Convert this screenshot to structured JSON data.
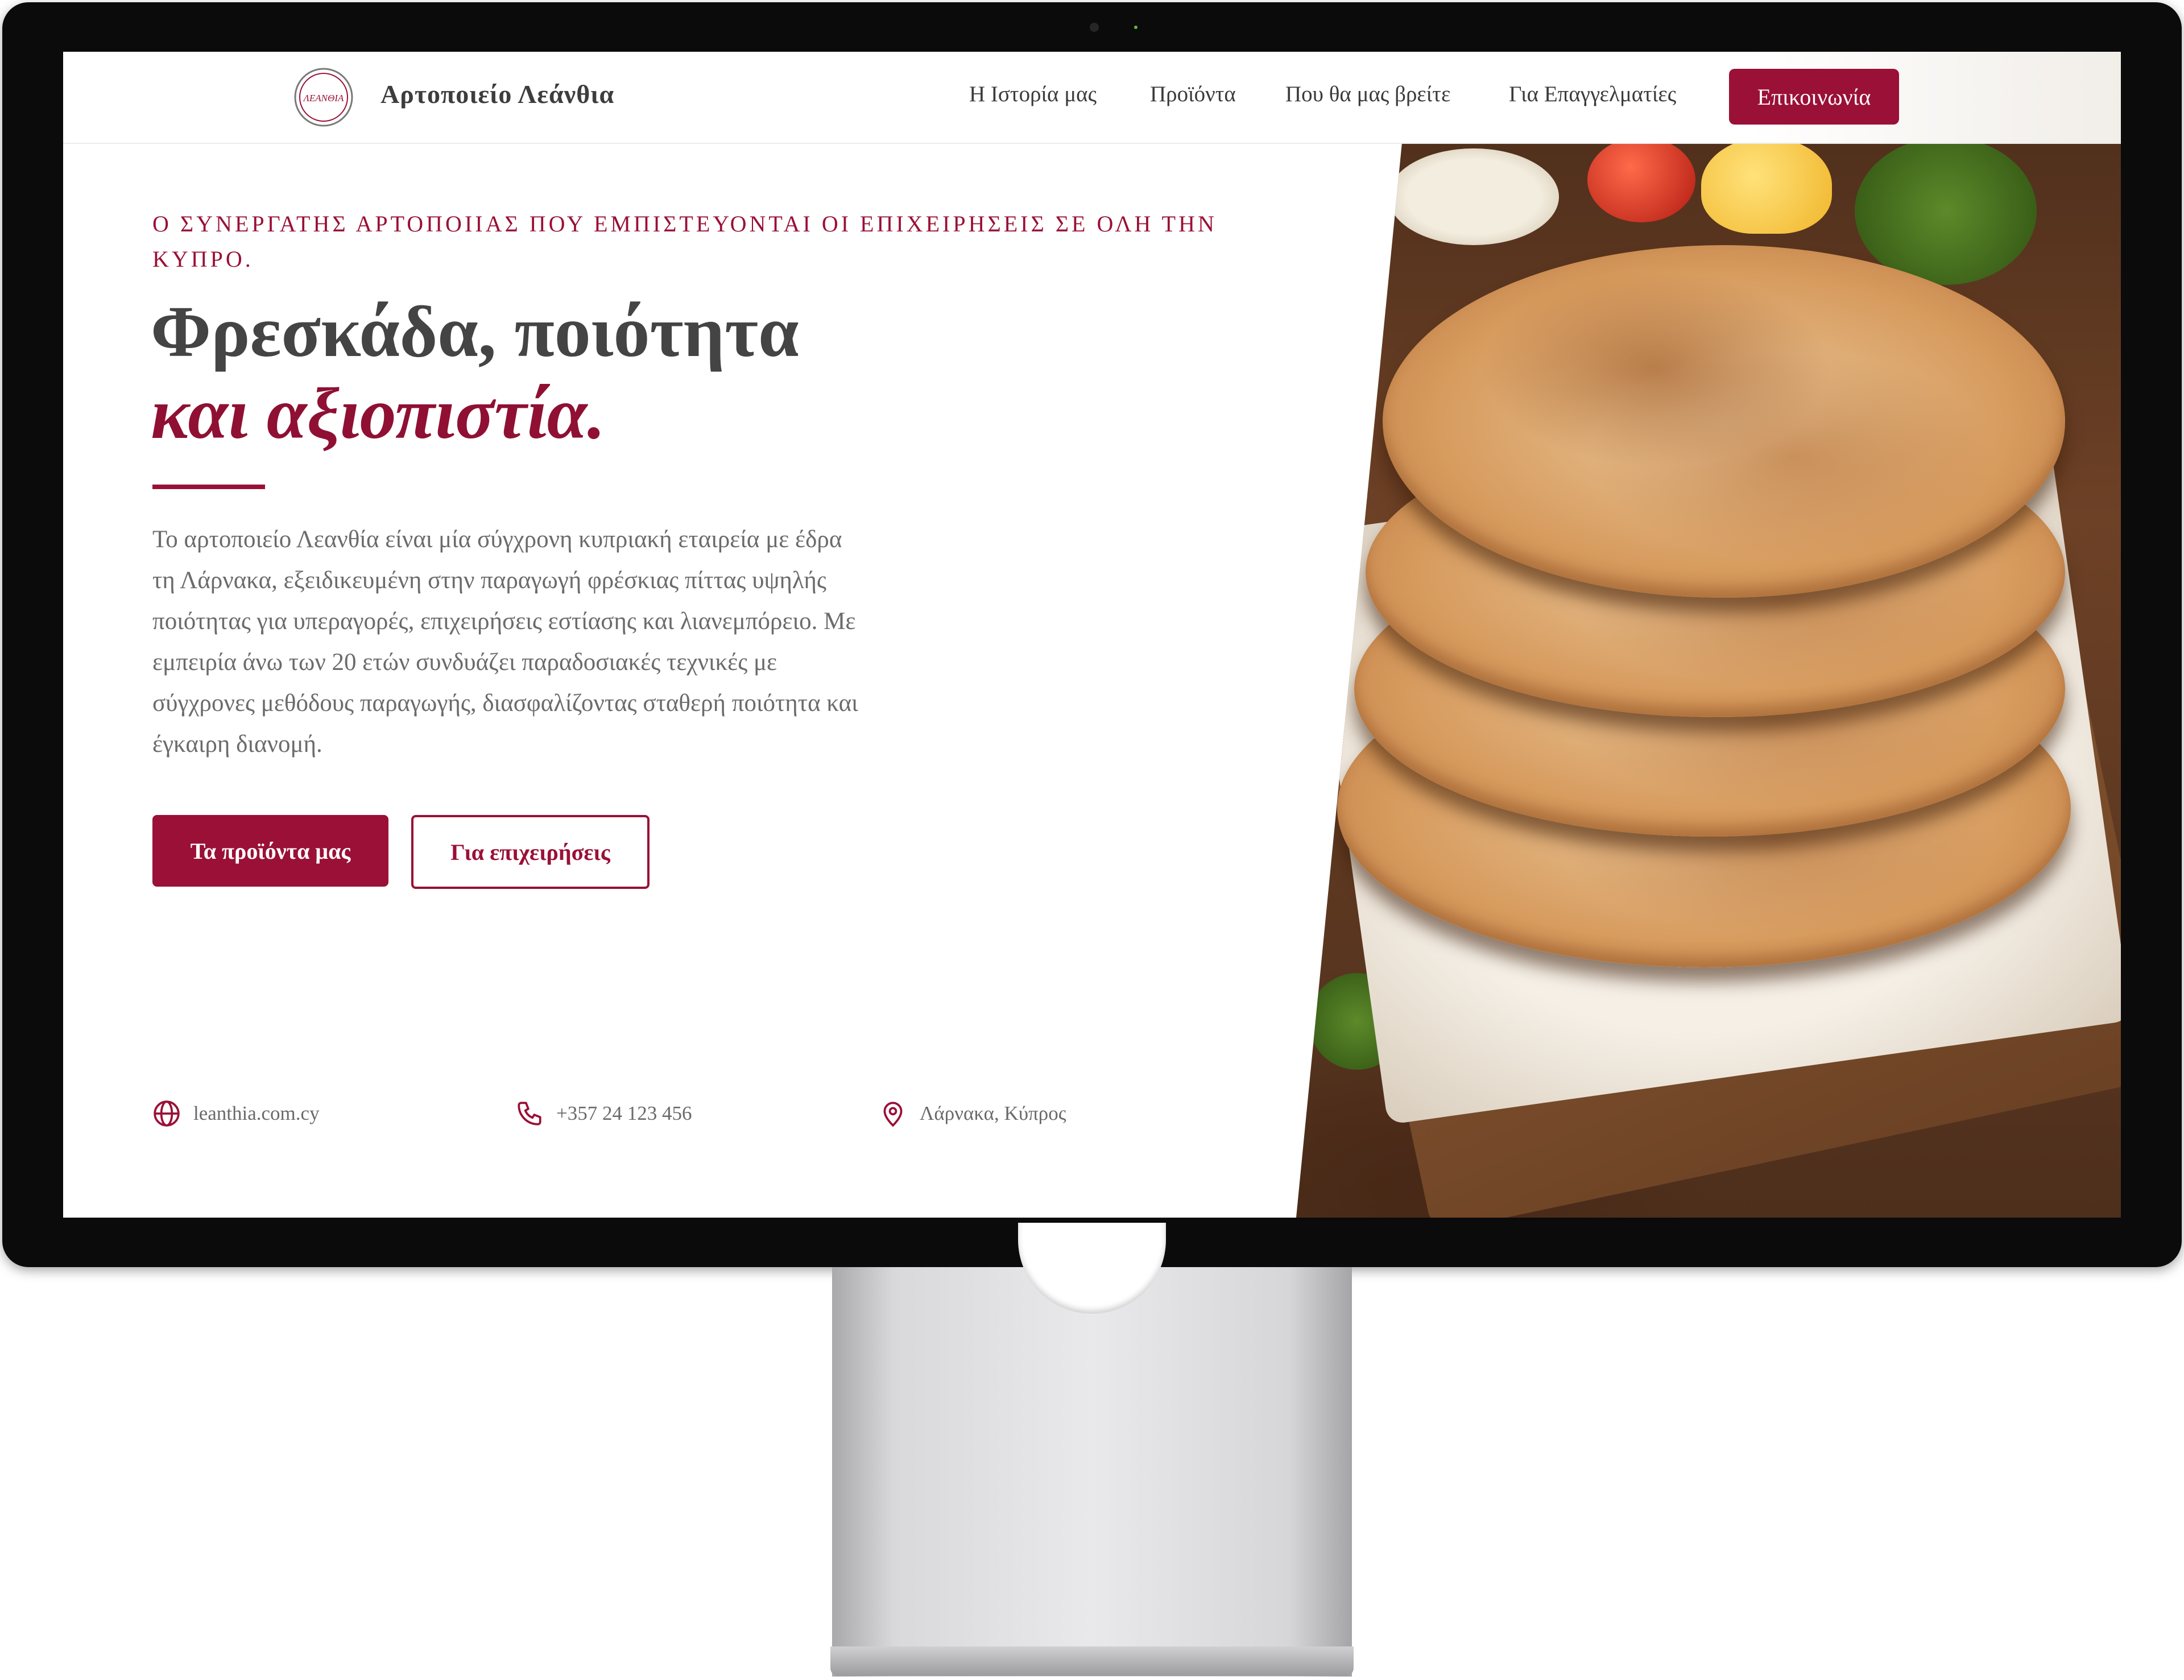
{
  "brand": {
    "name": "Αρτοποιείο Λεάνθια",
    "logo_text": "ΛΕΑΝΘΙΑ"
  },
  "nav": {
    "items": [
      {
        "label": "Η Ιστορία μας"
      },
      {
        "label": "Προϊόντα"
      },
      {
        "label": "Που θα μας βρείτε"
      },
      {
        "label": "Για Επαγγελματίες"
      }
    ],
    "cta_label": "Επικοινωνία"
  },
  "hero": {
    "eyebrow": "Ο ΣΥΝΕΡΓΑΤΗΣ ΑΡΤΟΠΟΙΙΑΣ ΠΟΥ ΕΜΠΙΣΤΕΥΟΝΤΑΙ ΟΙ ΕΠΙΧΕΙΡΗΣΕΙΣ ΣΕ ΟΛΗ ΤΗΝ ΚΥΠΡΟ.",
    "headline_line1": "Φρεσκάδα, ποιότητα",
    "headline_line2": "και αξιοπιστία.",
    "intro": "Το αρτοποιείο Λεανθία είναι μία σύγχρονη κυπριακή εταιρεία με έδρα τη Λάρνακα, εξειδικευμένη στην παραγωγή φρέσκιας πίττας υψηλής ποιότητας για υπεραγορές, επιχειρήσεις εστίασης και λιανεμπόρειο. Με εμπειρία άνω των 20 ετών συνδυάζει παραδοσιακές τεχνικές με σύγχρονες μεθόδους παραγωγής, διασφαλίζοντας σταθερή ποιότητα και έγκαιρη διανομή.",
    "primary_button": "Τα προϊόντα μας",
    "secondary_button": "Για επιχειρήσεις"
  },
  "contact": {
    "website": "leanthia.com.cy",
    "phone": "+357 24 123 456",
    "location": "Λάρνακα, Κύπρος"
  },
  "icons": {
    "website": "globe-icon",
    "phone": "phone-icon",
    "location": "map-pin-icon"
  },
  "colors": {
    "accent": "#9a1036",
    "heading": "#444444",
    "body_text": "#6b6b6b"
  }
}
